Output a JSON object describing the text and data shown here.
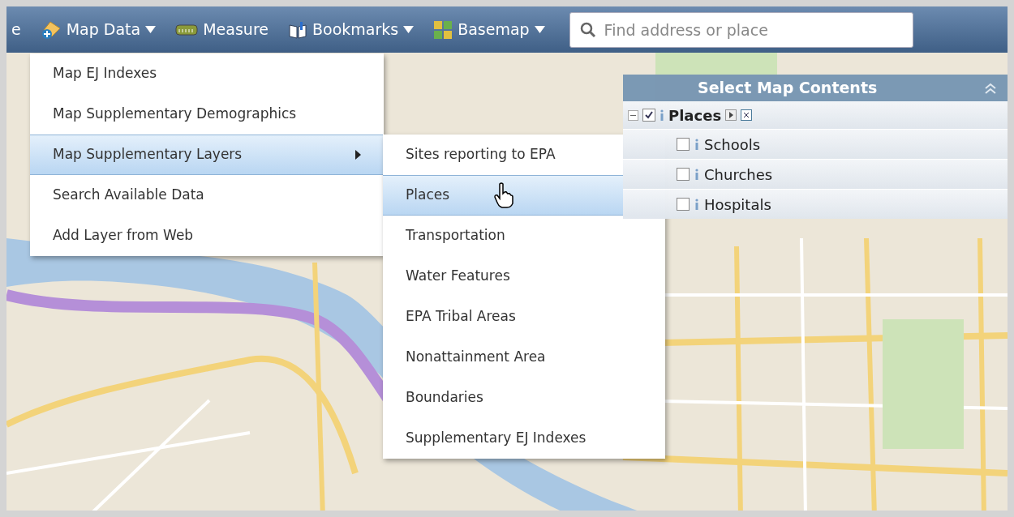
{
  "toolbar": {
    "items": [
      {
        "label": "e",
        "kind": "cut",
        "dropdown": false
      },
      {
        "label": "Map Data",
        "kind": "add-data",
        "dropdown": true
      },
      {
        "label": "Measure",
        "kind": "measure",
        "dropdown": false
      },
      {
        "label": "Bookmarks",
        "kind": "bookmarks",
        "dropdown": true
      },
      {
        "label": "Basemap",
        "kind": "basemap",
        "dropdown": true
      }
    ],
    "search": {
      "placeholder": "Find address or place"
    }
  },
  "menu": {
    "items": [
      {
        "label": "Map EJ Indexes",
        "selected": false,
        "submenu": false
      },
      {
        "label": "Map Supplementary Demographics",
        "selected": false,
        "submenu": false
      },
      {
        "label": "Map Supplementary Layers",
        "selected": true,
        "submenu": true
      },
      {
        "label": "Search Available Data",
        "selected": false,
        "submenu": false
      },
      {
        "label": "Add Layer from Web",
        "selected": false,
        "submenu": false
      }
    ]
  },
  "submenu": {
    "items": [
      {
        "label": "Sites reporting to EPA",
        "selected": false
      },
      {
        "label": "Places",
        "selected": true
      },
      {
        "label": "Transportation",
        "selected": false
      },
      {
        "label": "Water Features",
        "selected": false
      },
      {
        "label": "EPA Tribal Areas",
        "selected": false
      },
      {
        "label": "Nonattainment Area",
        "selected": false
      },
      {
        "label": "Boundaries",
        "selected": false
      },
      {
        "label": "Supplementary EJ Indexes",
        "selected": false
      }
    ]
  },
  "contents_panel": {
    "title": "Select Map Contents",
    "layers": [
      {
        "label": "Places",
        "checked": true,
        "expanded": true,
        "children": [
          {
            "label": "Schools",
            "checked": false
          },
          {
            "label": "Churches",
            "checked": false
          },
          {
            "label": "Hospitals",
            "checked": false
          }
        ]
      }
    ]
  }
}
